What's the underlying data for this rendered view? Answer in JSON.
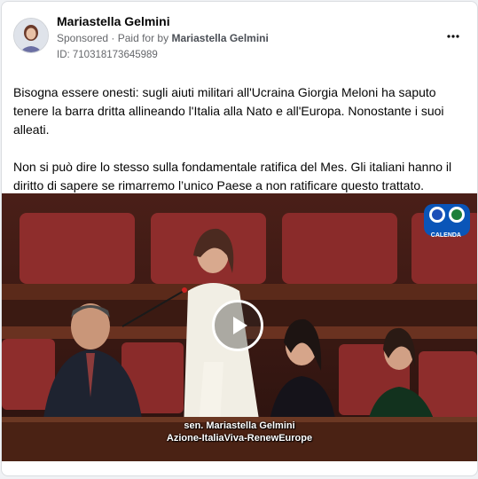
{
  "post": {
    "author": "Mariastella Gelmini",
    "sponsored": "Sponsored",
    "paid_prefix": "Paid for by",
    "paid_by": "Mariastella Gelmini",
    "ad_id": "ID: 710318173645989",
    "more_icon": "more-options-icon",
    "paragraph_1": "Bisogna essere onesti: sugli aiuti militari all'Ucraina Giorgia Meloni ha saputo tenere la barra dritta allineando l'Italia alla Nato e all'Europa. Nonostante i suoi alleati.",
    "paragraph_2": "Non si può dire lo stesso sulla fondamentale ratifica del Mes. Gli italiani hanno il diritto di sapere se rimarremo l’unico Paese a non ratificare questo trattato."
  },
  "video": {
    "caption_line_1": "sen. Mariastella Gelmini",
    "caption_line_2": "Azione-ItaliaViva-RenewEurope",
    "badge_text": "CALENDA",
    "play_icon": "play-icon",
    "colors": {
      "chamber_red": "#8a2b2a",
      "wood": "#5b2a1a",
      "accent_blue": "#1877f2"
    }
  }
}
